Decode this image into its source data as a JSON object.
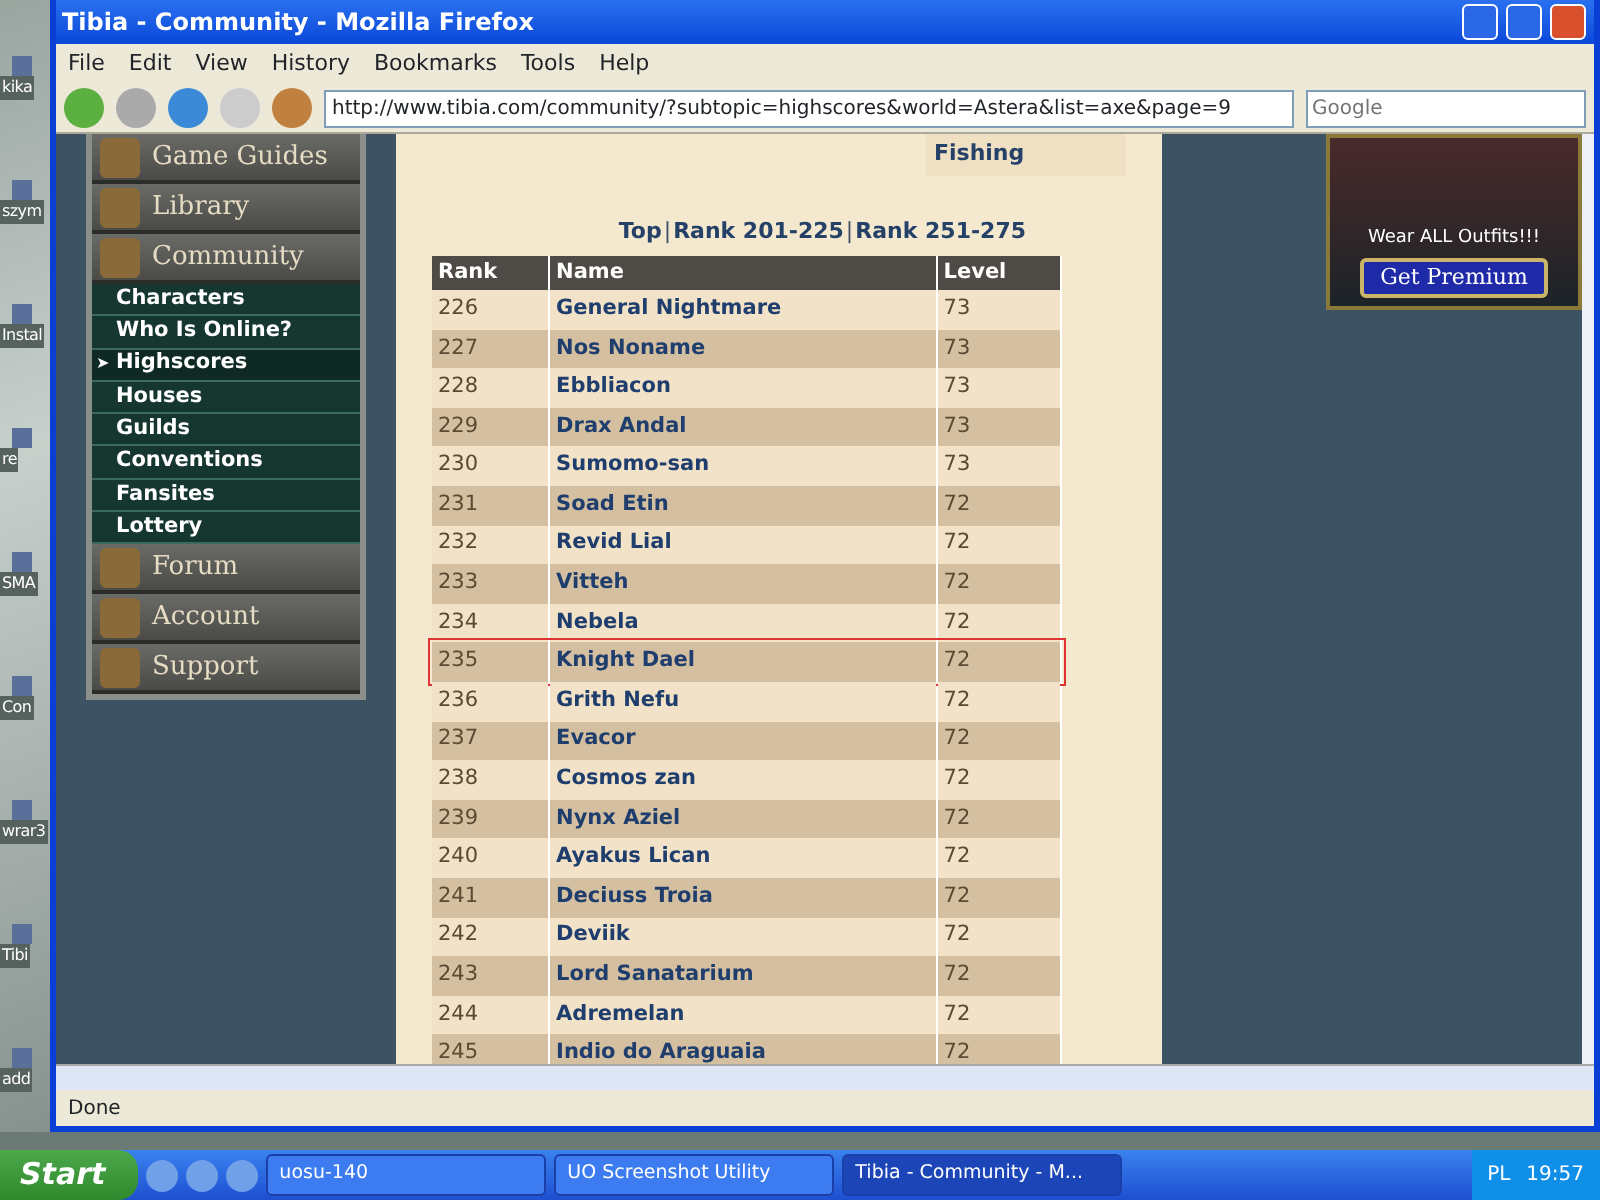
{
  "desktop": {
    "icons": [
      {
        "label": "kika"
      },
      {
        "label": "szym"
      },
      {
        "label": "Instal"
      },
      {
        "label": "re"
      },
      {
        "label": "SMA"
      },
      {
        "label": "Con"
      },
      {
        "label": "wrar3"
      },
      {
        "label": "Tibi"
      },
      {
        "label": "add"
      }
    ]
  },
  "window": {
    "title": "Tibia - Community - Mozilla Firefox",
    "menu": [
      "File",
      "Edit",
      "View",
      "History",
      "Bookmarks",
      "Tools",
      "Help"
    ],
    "url": "http://www.tibia.com/community/?subtopic=highscores&world=Astera&list=axe&page=9",
    "search_placeholder": "Google"
  },
  "sidebar": {
    "pointer": "➤",
    "sections": [
      {
        "label": "Game Guides"
      },
      {
        "label": "Library"
      },
      {
        "label": "Community",
        "children": [
          {
            "label": "Characters",
            "selected": false
          },
          {
            "label": "Who Is Online?",
            "selected": false
          },
          {
            "label": "Highscores",
            "selected": true
          },
          {
            "label": "Houses",
            "selected": false
          },
          {
            "label": "Guilds",
            "selected": false
          },
          {
            "label": "Conventions",
            "selected": false
          },
          {
            "label": "Fansites",
            "selected": false
          },
          {
            "label": "Lottery",
            "selected": false
          }
        ]
      },
      {
        "label": "Forum"
      },
      {
        "label": "Account"
      },
      {
        "label": "Support"
      }
    ]
  },
  "skill_list": [
    "Fishing"
  ],
  "pager": [
    {
      "kind": "link",
      "text": "Top"
    },
    {
      "kind": "separator",
      "text": "|"
    },
    {
      "kind": "link",
      "text": "Rank 201-225"
    },
    {
      "kind": "separator",
      "text": "|"
    },
    {
      "kind": "link",
      "text": "Rank 251-275"
    }
  ],
  "table": {
    "columns": [
      "Rank",
      "Name",
      "Level"
    ],
    "rows": [
      {
        "rank": "226",
        "name": "General Nightmare",
        "level": "73",
        "highlighted": false
      },
      {
        "rank": "227",
        "name": "Nos Noname",
        "level": "73",
        "highlighted": false
      },
      {
        "rank": "228",
        "name": "Ebbliacon",
        "level": "73",
        "highlighted": false
      },
      {
        "rank": "229",
        "name": "Drax Andal",
        "level": "73",
        "highlighted": false
      },
      {
        "rank": "230",
        "name": "Sumomo-san",
        "level": "73",
        "highlighted": false
      },
      {
        "rank": "231",
        "name": "Soad Etin",
        "level": "72",
        "highlighted": false
      },
      {
        "rank": "232",
        "name": "Revid Lial",
        "level": "72",
        "highlighted": false
      },
      {
        "rank": "233",
        "name": "Vitteh",
        "level": "72",
        "highlighted": false
      },
      {
        "rank": "234",
        "name": "Nebela",
        "level": "72",
        "highlighted": false
      },
      {
        "rank": "235",
        "name": "Knight Dael",
        "level": "72",
        "highlighted": true
      },
      {
        "rank": "236",
        "name": "Grith Nefu",
        "level": "72",
        "highlighted": false
      },
      {
        "rank": "237",
        "name": "Evacor",
        "level": "72",
        "highlighted": false
      },
      {
        "rank": "238",
        "name": "Cosmos zan",
        "level": "72",
        "highlighted": false
      },
      {
        "rank": "239",
        "name": "Nynx Aziel",
        "level": "72",
        "highlighted": false
      },
      {
        "rank": "240",
        "name": "Ayakus Lican",
        "level": "72",
        "highlighted": false
      },
      {
        "rank": "241",
        "name": "Deciuss Troia",
        "level": "72",
        "highlighted": false
      },
      {
        "rank": "242",
        "name": "Deviik",
        "level": "72",
        "highlighted": false
      },
      {
        "rank": "243",
        "name": "Lord Sanatarium",
        "level": "72",
        "highlighted": false
      },
      {
        "rank": "244",
        "name": "Adremelan",
        "level": "72",
        "highlighted": false
      },
      {
        "rank": "245",
        "name": "Indio do Araguaia",
        "level": "72",
        "highlighted": false
      }
    ]
  },
  "ad": {
    "caption": "Wear ALL Outfits!!!",
    "button": "Get Premium"
  },
  "status_bar": "Done",
  "taskbar": {
    "start": "Start",
    "tasks": [
      {
        "label": "uosu-140",
        "selected": false
      },
      {
        "label": "UO Screenshot Utility",
        "selected": false
      },
      {
        "label": "Tibia - Community - M...",
        "selected": true
      }
    ],
    "language": "PL",
    "clock": "19:57"
  }
}
